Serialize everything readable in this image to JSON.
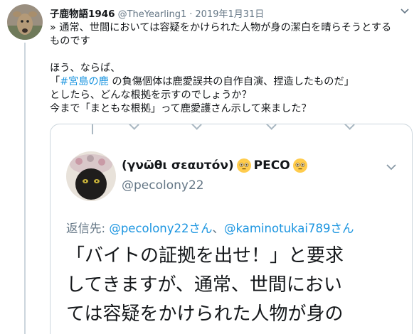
{
  "tweet": {
    "author_name": "子鹿物語1946",
    "author_handle": "@TheYearling1",
    "separator": "·",
    "date": "2019年1月31日",
    "lines": [
      "» 通常、世間においては容疑をかけられた人物が身の潔白を晴らそうとする",
      "ものです",
      "",
      "ほう、ならば、"
    ],
    "line5_pre": "「",
    "line5_hashtag": "#宮島の鹿",
    "line5_post": " の負傷個体は鹿愛誤共の自作自演、捏造したものだ」",
    "line6": "としたら、どんな根拠を示すのでしょうか？",
    "line7": "今まで「まともな根拠」って鹿愛護さん示して来ました？"
  },
  "embedded": {
    "name_pre": "(γνῶθι σεαυτόν)",
    "name_mid": "PECO",
    "handle": "@pecolony22",
    "reply_prefix": "返信先: ",
    "reply_mention1": "@pecolony22さん",
    "reply_sep": "、",
    "reply_mention2": "@kaminotukai789さん",
    "text_lines": [
      "「バイトの証拠を出せ！」と要求",
      "してきますが、通常、世間におい",
      "ては容疑をかけられた人物が身の"
    ]
  },
  "colors": {
    "link": "#1b95e0",
    "muted": "#657786",
    "text": "#14171a",
    "border": "#ccd6dd"
  },
  "icons": {
    "caret": "chevron-down-icon",
    "emoji": "flushed-face-emoji"
  }
}
